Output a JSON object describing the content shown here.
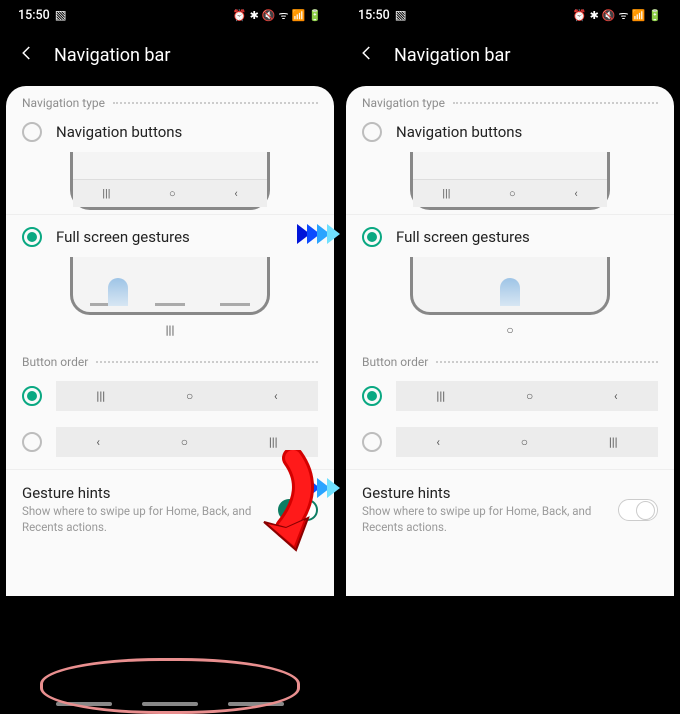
{
  "status": {
    "time": "15:50",
    "alarm": "⏰",
    "bt": "✱",
    "mute": "🔇",
    "wifi": "ᯤ",
    "signal": "📶",
    "battery": "🔋"
  },
  "header": {
    "title": "Navigation bar"
  },
  "sections": {
    "nav_type_label": "Navigation type",
    "button_order_label": "Button order"
  },
  "options": {
    "nav_buttons": "Navigation buttons",
    "full_gestures": "Full screen gestures"
  },
  "glyphs": {
    "recents": "|||",
    "home": "○",
    "back": "‹",
    "back_alt": "‹",
    "pic": "▧"
  },
  "under_preview": {
    "left_recents": "|||",
    "center_home": "○"
  },
  "hints": {
    "title": "Gesture hints",
    "desc": "Show where to swipe up for Home, Back, and Recents actions."
  },
  "left_screen": {
    "gesture_hints_on": true
  },
  "right_screen": {
    "gesture_hints_on": false
  }
}
